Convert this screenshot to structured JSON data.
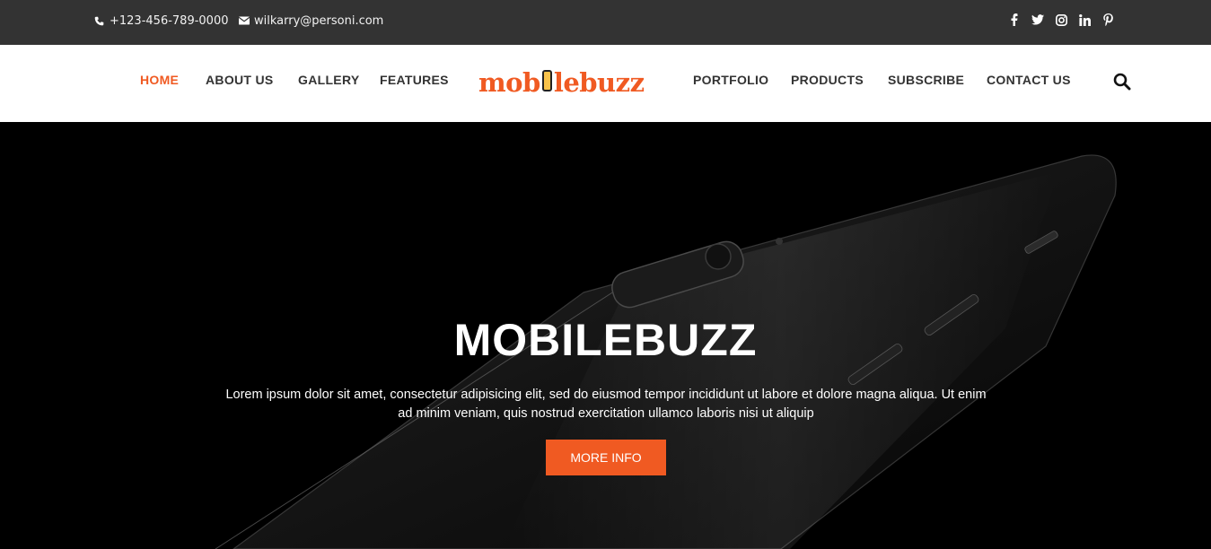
{
  "topbar": {
    "phone": "+123-456-789-0000",
    "email": "wilkarry@personi.com",
    "social": [
      "facebook-icon",
      "twitter-icon",
      "instagram-icon",
      "linkedin-icon",
      "pinterest-icon"
    ]
  },
  "nav": {
    "left": [
      "HOME",
      "ABOUT US",
      "GALLERY",
      "FEATURES"
    ],
    "right": [
      "PORTFOLIO",
      "PRODUCTS",
      "SUBSCRIBE",
      "CONTACT US"
    ],
    "active": "HOME",
    "logo": {
      "part1": "mob",
      "part2": "lebuzz"
    },
    "search_icon": "search-icon"
  },
  "hero": {
    "title": "MOBILEBUZZ",
    "text_line1": "Lorem ipsum dolor sit amet, consectetur adipisicing elit, sed do eiusmod tempor incididunt ut labore et dolore magna aliqua. Ut enim",
    "text_line2": "ad minim veniam, quis nostrud exercitation ullamco laboris nisi ut aliquip",
    "button": "MORE INFO"
  },
  "colors": {
    "accent": "#f05a22",
    "topbar": "#333333",
    "nav_text": "#333333",
    "hero_bg": "#000000"
  }
}
